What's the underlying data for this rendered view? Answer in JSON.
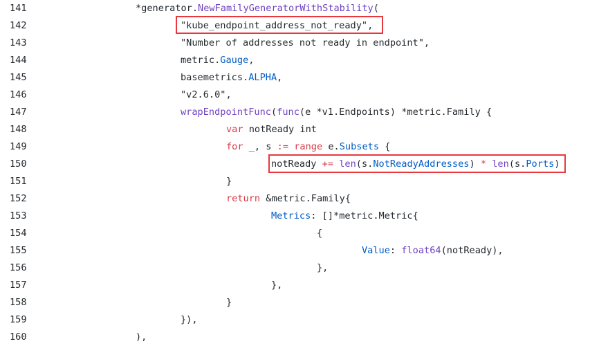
{
  "lines": [
    {
      "num": "141",
      "tokens": [
        [
          "plain",
          "*generator."
        ],
        [
          "fn",
          "NewFamilyGeneratorWithStability"
        ],
        [
          "plain",
          "("
        ]
      ]
    },
    {
      "num": "142",
      "tokens": [
        [
          "plain",
          "\"kube_endpoint_address_not_ready\","
        ]
      ]
    },
    {
      "num": "143",
      "tokens": [
        [
          "plain",
          "\"Number of addresses not ready in endpoint\","
        ]
      ]
    },
    {
      "num": "144",
      "tokens": [
        [
          "plain",
          "metric."
        ],
        [
          "prop",
          "Gauge"
        ],
        [
          "plain",
          ","
        ]
      ]
    },
    {
      "num": "145",
      "tokens": [
        [
          "plain",
          "basemetrics."
        ],
        [
          "prop",
          "ALPHA"
        ],
        [
          "plain",
          ","
        ]
      ]
    },
    {
      "num": "146",
      "tokens": [
        [
          "plain",
          "\"v2.6.0\","
        ]
      ]
    },
    {
      "num": "147",
      "tokens": [
        [
          "fn",
          "wrapEndpointFunc"
        ],
        [
          "plain",
          "("
        ],
        [
          "fn",
          "func"
        ],
        [
          "plain",
          "(e *v1.Endpoints) *metric.Family {"
        ]
      ]
    },
    {
      "num": "148",
      "tokens": [
        [
          "kw",
          "var"
        ],
        [
          "plain",
          " notReady int"
        ]
      ]
    },
    {
      "num": "149",
      "tokens": [
        [
          "kw",
          "for"
        ],
        [
          "plain",
          " _, s "
        ],
        [
          "kw",
          ":="
        ],
        [
          "plain",
          " "
        ],
        [
          "kw",
          "range"
        ],
        [
          "plain",
          " e."
        ],
        [
          "prop",
          "Subsets"
        ],
        [
          "plain",
          " {"
        ]
      ]
    },
    {
      "num": "150",
      "tokens": [
        [
          "plain",
          "notReady "
        ],
        [
          "kw",
          "+="
        ],
        [
          "plain",
          " "
        ],
        [
          "fn",
          "len"
        ],
        [
          "plain",
          "(s."
        ],
        [
          "prop",
          "NotReadyAddresses"
        ],
        [
          "plain",
          ") "
        ],
        [
          "kw",
          "*"
        ],
        [
          "plain",
          " "
        ],
        [
          "fn",
          "len"
        ],
        [
          "plain",
          "(s."
        ],
        [
          "prop",
          "Ports"
        ],
        [
          "plain",
          ")"
        ]
      ]
    },
    {
      "num": "151",
      "tokens": [
        [
          "plain",
          "}"
        ]
      ]
    },
    {
      "num": "152",
      "tokens": [
        [
          "kw",
          "return"
        ],
        [
          "plain",
          " &metric.Family{"
        ]
      ]
    },
    {
      "num": "153",
      "tokens": [
        [
          "prop",
          "Metrics"
        ],
        [
          "plain",
          ": []*metric.Metric{"
        ]
      ]
    },
    {
      "num": "154",
      "tokens": [
        [
          "plain",
          "{"
        ]
      ]
    },
    {
      "num": "155",
      "tokens": [
        [
          "prop",
          "Value"
        ],
        [
          "plain",
          ": "
        ],
        [
          "fn",
          "float64"
        ],
        [
          "plain",
          "(notReady),"
        ]
      ]
    },
    {
      "num": "156",
      "tokens": [
        [
          "plain",
          "},"
        ]
      ]
    },
    {
      "num": "157",
      "tokens": [
        [
          "plain",
          "},"
        ]
      ]
    },
    {
      "num": "158",
      "tokens": [
        [
          "plain",
          "}"
        ]
      ]
    },
    {
      "num": "159",
      "tokens": [
        [
          "plain",
          "}),"
        ]
      ]
    },
    {
      "num": "160",
      "tokens": [
        [
          "plain",
          "),"
        ]
      ]
    }
  ]
}
